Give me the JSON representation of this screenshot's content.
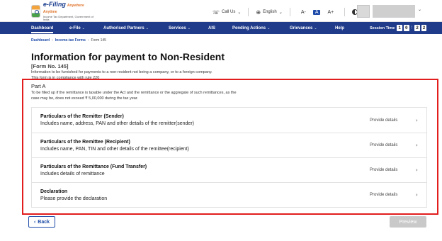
{
  "header": {
    "logo_title": "e-Filing",
    "logo_tagline": "Anywhere Anytime",
    "logo_sub": "Income Tax Department, Government of India",
    "call_us": "Call Us",
    "language": "English",
    "font_small": "A-",
    "font_normal": "A",
    "font_large": "A+"
  },
  "nav": {
    "items": [
      {
        "label": "Dashboard",
        "has_dropdown": false
      },
      {
        "label": "e-File",
        "has_dropdown": true
      },
      {
        "label": "Authorised Partners",
        "has_dropdown": true
      },
      {
        "label": "Services",
        "has_dropdown": true
      },
      {
        "label": "AIS",
        "has_dropdown": false
      },
      {
        "label": "Pending Actions",
        "has_dropdown": true
      },
      {
        "label": "Grievances",
        "has_dropdown": true
      },
      {
        "label": "Help",
        "has_dropdown": false
      }
    ],
    "session_label": "Session Time",
    "timer": [
      "1",
      "0",
      "2",
      "2"
    ]
  },
  "breadcrumb": {
    "items": [
      "Dashboard",
      "Income-tax Forms",
      "Form 145"
    ]
  },
  "page": {
    "title": "Information for payment to Non-Resident",
    "form_no": "[Form No. 145]",
    "desc_line1": "Information to be furnished for payments to a non-resident not being a company, or to a foreign company.",
    "desc_line2": "This form is in compliance with rule 220"
  },
  "part_a": {
    "title": "Part A",
    "note_line1": "To be filled up if the remittance is taxable under the Act  and the remittance or the aggregate of such remittances, as the",
    "note_line2": "case may be, does not exceed ₹ 5,00,000 during the tax year.",
    "cards": [
      {
        "title": "Particulars of the Remitter (Sender)",
        "subtitle": "Includes name, address, PAN and other details of the remitter(sender)",
        "action": "Provide details"
      },
      {
        "title": "Particulars of the Remittee (Recipient)",
        "subtitle": "Includes name, PAN, TIN and other details of the remittee(recipient)",
        "action": "Provide details"
      },
      {
        "title": "Particulars of the Remittance (Fund Transfer)",
        "subtitle": "Includes details of remittance",
        "action": "Provide details"
      },
      {
        "title": "Declaration",
        "subtitle": "Please provide the declaration",
        "action": "Provide details"
      }
    ]
  },
  "footer": {
    "back_label": "Back",
    "preview_label": "Preview"
  },
  "colors": {
    "nav_bg": "#1f3b8a",
    "accent": "#1d4aa8",
    "highlight_border": "#e11d1d",
    "disabled_button": "#c9c9c9"
  }
}
